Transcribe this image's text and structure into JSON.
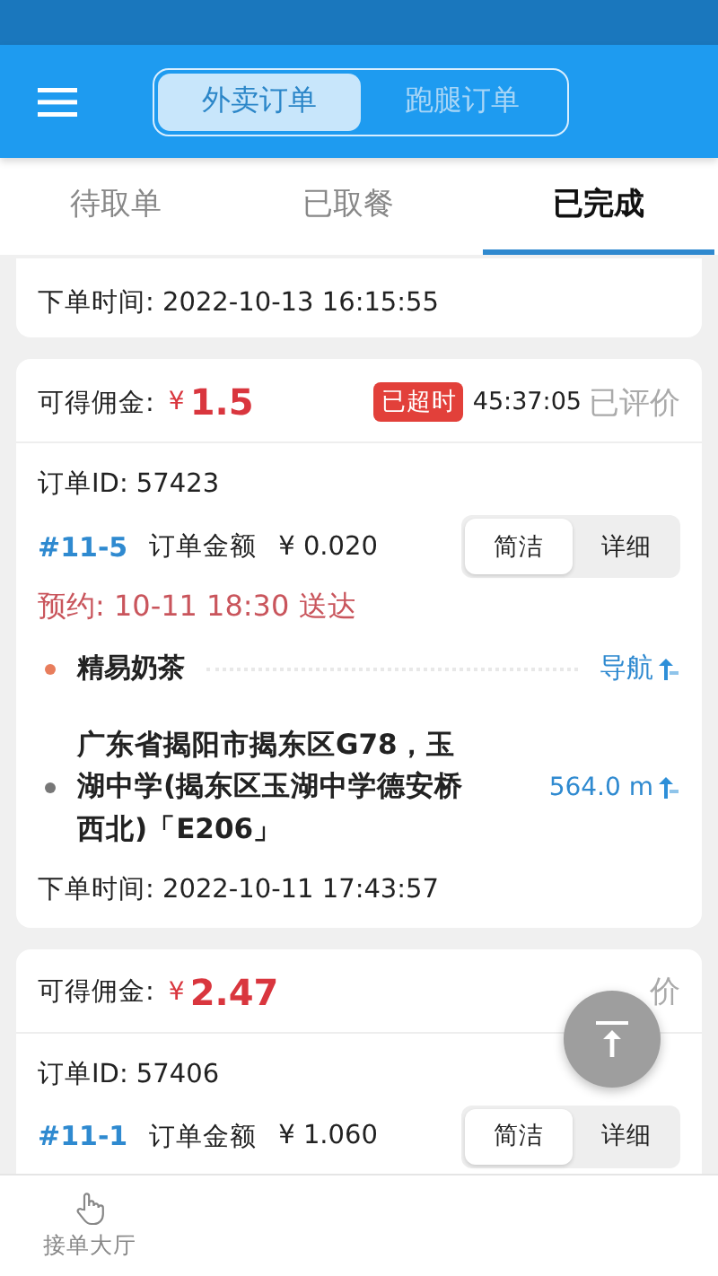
{
  "header": {
    "segments": [
      {
        "label": "外卖订单",
        "selected": true
      },
      {
        "label": "跑腿订单",
        "selected": false
      }
    ]
  },
  "tabs": [
    {
      "label": "待取单",
      "selected": false
    },
    {
      "label": "已取餐",
      "selected": false
    },
    {
      "label": "已完成",
      "selected": true
    }
  ],
  "partial_card": {
    "order_time_label": "下单时间:",
    "order_time": "2022-10-13 16:15:55"
  },
  "orders": [
    {
      "commission_label": "可得佣金:",
      "currency": "¥",
      "commission": "1.5",
      "overdue": {
        "label": "已超时",
        "timer": "45:37:05"
      },
      "status": "已评价",
      "order_id": "订单ID: 57423",
      "tag": "#11-5",
      "amount_label": "订单金额",
      "amount": "¥ 0.020",
      "views": [
        {
          "label": "简洁",
          "selected": true
        },
        {
          "label": "详细",
          "selected": false
        }
      ],
      "reservation": "预约: 10-11  18:30 送达",
      "shop": {
        "name": "精易奶茶",
        "action": "导航"
      },
      "address": {
        "text": "广东省揭阳市揭东区G78，玉湖中学(揭东区玉湖中学德安桥西北)「E206」",
        "distance": "564.0 m"
      },
      "order_time_label": "下单时间:",
      "order_time": "2022-10-11 17:43:57"
    },
    {
      "commission_label": "可得佣金:",
      "currency": "¥",
      "commission": "2.47",
      "status": "价",
      "order_id": "订单ID: 57406",
      "tag": "#11-1",
      "amount_label": "订单金额",
      "amount": "¥ 1.060",
      "views": [
        {
          "label": "简洁",
          "selected": true
        },
        {
          "label": "详细",
          "selected": false
        }
      ]
    }
  ],
  "bottom_nav": [
    {
      "label": "接单大厅"
    }
  ]
}
